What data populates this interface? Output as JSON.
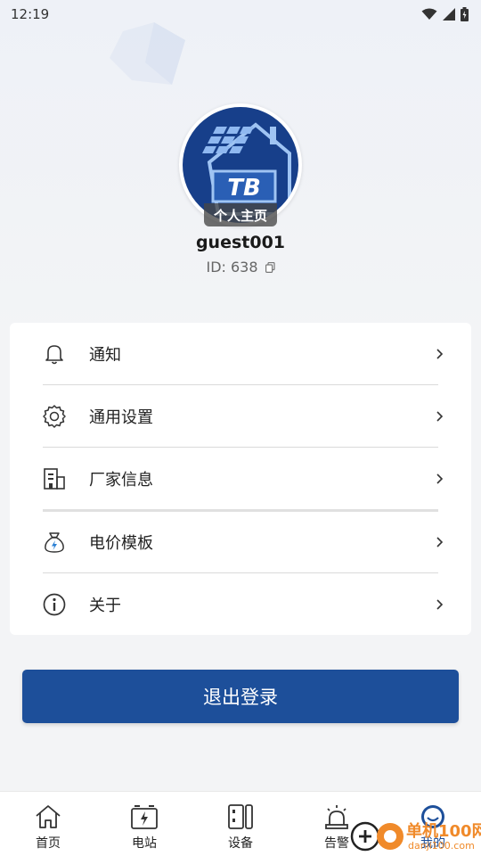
{
  "status_bar": {
    "time": "12:19"
  },
  "profile": {
    "logo_text": "TB",
    "badge_label": "个人主页",
    "username": "guest001",
    "user_id": "ID: 638"
  },
  "menu": {
    "items": [
      {
        "label": "通知",
        "icon": "bell-icon"
      },
      {
        "label": "通用设置",
        "icon": "gear-icon"
      },
      {
        "label": "厂家信息",
        "icon": "building-icon"
      },
      {
        "label": "电价模板",
        "icon": "money-bag-icon"
      },
      {
        "label": "关于",
        "icon": "info-icon"
      }
    ]
  },
  "logout": {
    "label": "退出登录"
  },
  "bottom_nav": {
    "items": [
      {
        "label": "首页",
        "icon": "home-icon"
      },
      {
        "label": "电站",
        "icon": "battery-station-icon"
      },
      {
        "label": "设备",
        "icon": "device-icon"
      },
      {
        "label": "告警",
        "icon": "alarm-icon"
      },
      {
        "label": "我的",
        "icon": "profile-icon"
      }
    ],
    "active_index": 4
  },
  "watermark": {
    "text": "单机100网",
    "sub": "danji100.com"
  },
  "colors": {
    "primary": "#1d4f9a",
    "background": "#f3f4f6",
    "watermark": "#f08a2a"
  }
}
